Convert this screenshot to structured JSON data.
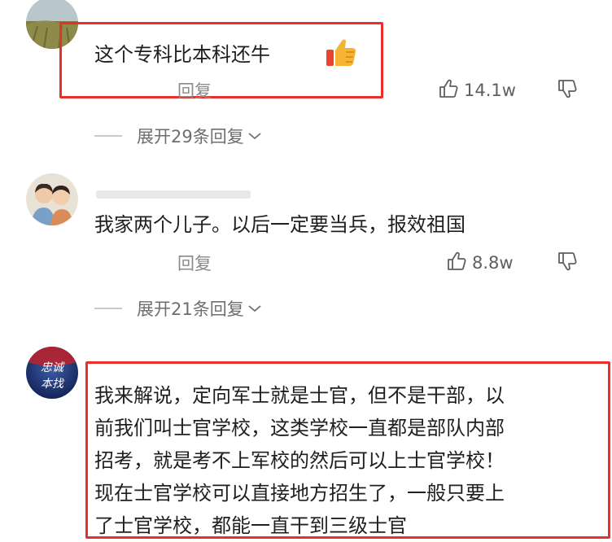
{
  "comments": [
    {
      "text": "这个专科比本科还牛",
      "reply_label": "回复",
      "like_count": "14.1w",
      "expand_label": "展开29条回复"
    },
    {
      "text": "我家两个儿子。以后一定要当兵，报效祖国",
      "reply_label": "回复",
      "like_count": "8.8w",
      "expand_label": "展开21条回复"
    },
    {
      "avatar_text": [
        "忠诚",
        "本找"
      ],
      "lines": [
        "我来解说，定向军士就是士官，但不是干部，以",
        "前我们叫士官学校，这类学校一直都是部队内部",
        "招考，就是考不上军校的然后可以上士官学校！",
        "现在士官学校可以直接地方招生了，一般只要上",
        "了士官学校，都能一直干到三级士官"
      ]
    }
  ],
  "icons": {
    "thumbs_up": "thumbs-up-icon",
    "thumbs_down": "thumbs-down-icon",
    "chevron_down": "chevron-down-icon",
    "thumbs_up_emoji": "thumbs-up-emoji-icon"
  },
  "colors": {
    "highlight_box": "#e8302a",
    "secondary_text": "#8a8a8a"
  }
}
